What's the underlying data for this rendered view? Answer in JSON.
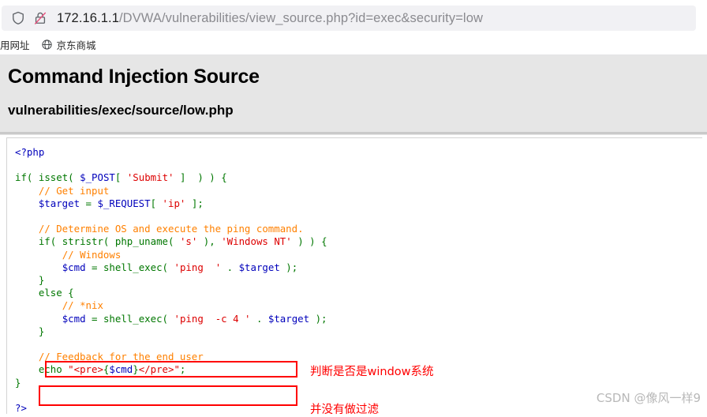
{
  "browser": {
    "shield_icon": "shield-icon",
    "insecure_icon": "insecure-lock-icon",
    "url_host": "172.16.1.1",
    "url_path": "/DVWA/vulnerabilities/view_source.php?id=exec&security=low",
    "url_full": "172.16.1.1/DVWA/vulnerabilities/view_source.php?id=exec&security=low",
    "bookmarks": [
      {
        "label": "用网址",
        "icon": ""
      },
      {
        "label": "京东商城",
        "icon": "globe-icon"
      }
    ]
  },
  "page": {
    "title": "Command Injection Source",
    "subtitle": "vulnerabilities/exec/source/low.php"
  },
  "code": {
    "language": "php",
    "lines": [
      "<?php",
      "",
      "if( isset( $_POST[ 'Submit' ]  ) ) {",
      "    // Get input",
      "    $target = $_REQUEST[ 'ip' ];",
      "",
      "    // Determine OS and execute the ping command.",
      "    if( stristr( php_uname( 's' ), 'Windows NT' ) ) {",
      "        // Windows",
      "        $cmd = shell_exec( 'ping  ' . $target );",
      "    }",
      "    else {",
      "        // *nix",
      "        $cmd = shell_exec( 'ping  -c 4 ' . $target );",
      "    }",
      "",
      "    // Feedback for the end user",
      "    echo \"<pre>{$cmd}</pre>\";",
      "}",
      "",
      "?>"
    ]
  },
  "annotations": [
    {
      "id": "os-check",
      "text": "判断是否是window系统",
      "color": "#ff0000"
    },
    {
      "id": "no-filter",
      "text": "并没有做过滤",
      "color": "#ff0000"
    }
  ],
  "highlight_boxes": [
    {
      "id": "os-check-box",
      "color": "#ff0000"
    },
    {
      "id": "no-filter-box",
      "color": "#ff0000"
    }
  ],
  "watermark": {
    "text": "CSDN @像风一样9"
  },
  "colors": {
    "header_bg": "#e6e6e6",
    "divider": "#c9c9c9",
    "omnibox_bg": "#f1f1f4",
    "annotation_red": "#ff0000",
    "php_keyword": "#007700",
    "php_variable": "#0000bb",
    "php_string": "#dd0000",
    "php_comment": "#ff8000"
  }
}
